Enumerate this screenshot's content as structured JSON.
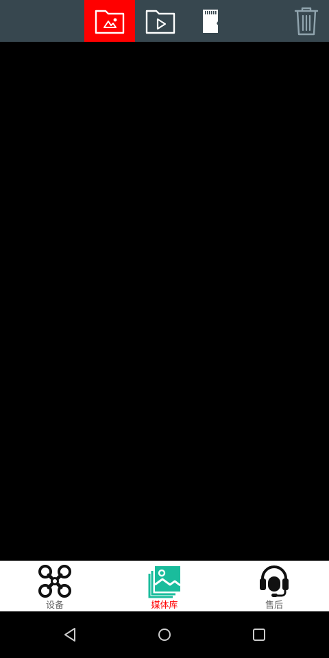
{
  "toolbar": {
    "items": [
      {
        "id": "photos",
        "icon": "image-folder-icon",
        "active": true
      },
      {
        "id": "videos",
        "icon": "video-folder-icon",
        "active": false
      },
      {
        "id": "sdcard",
        "icon": "sd-card-icon",
        "active": false
      }
    ],
    "delete_icon": "trash-icon",
    "background_color": "#37474f",
    "active_color": "#ff0000"
  },
  "content": {
    "background_color": "#000000"
  },
  "bottom_nav": {
    "items": [
      {
        "label": "设备",
        "icon": "drone-icon",
        "active": false
      },
      {
        "label": "媒体库",
        "icon": "gallery-icon",
        "active": true
      },
      {
        "label": "售后",
        "icon": "headset-icon",
        "active": false
      }
    ],
    "active_color": "#ff0000",
    "inactive_color": "#666666",
    "accent_color": "#1abc9c"
  },
  "system_nav": {
    "items": [
      {
        "icon": "back-triangle-icon"
      },
      {
        "icon": "home-circle-icon"
      },
      {
        "icon": "recent-square-icon"
      }
    ]
  }
}
